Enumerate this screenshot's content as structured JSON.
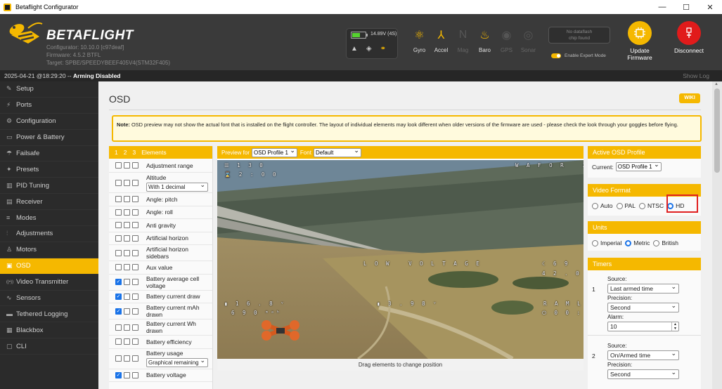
{
  "window": {
    "title": "Betaflight Configurator",
    "controls": [
      "—",
      "☐",
      "✕"
    ]
  },
  "header": {
    "brand": "BETAFLIGHT",
    "configurator": "Configurator: 10.10.0 [c97deaf]",
    "firmware": "Firmware: 4.5.2 BTFL",
    "target": "Target: SPBE/SPEEDYBEEF405V4(STM32F405)",
    "battery_text": "14.89V (4S)",
    "battery_level": 0.55,
    "sensors": [
      {
        "label": "Gyro",
        "icon": "gyro-icon",
        "active": true
      },
      {
        "label": "Accel",
        "icon": "accel-icon",
        "active": true
      },
      {
        "label": "Mag",
        "icon": "mag-icon",
        "active": false
      },
      {
        "label": "Baro",
        "icon": "baro-icon",
        "active": true
      },
      {
        "label": "GPS",
        "icon": "gps-icon",
        "active": false
      },
      {
        "label": "Sonar",
        "icon": "sonar-icon",
        "active": false
      }
    ],
    "dataflash_line1": "No dataflash",
    "dataflash_line2": "chip found",
    "expert_mode": "Enable Expert Mode",
    "update_line1": "Update",
    "update_line2": "Firmware",
    "disconnect": "Disconnect",
    "accent_color": "#f5b800",
    "disconnect_color": "#e11b1b"
  },
  "status": {
    "datetime": "2025-04-21 @18:29:20",
    "separator": " -- ",
    "arming": "Arming Disabled",
    "show_log": "Show Log"
  },
  "sidebar": {
    "items": [
      {
        "label": "Setup",
        "icon": "wrench-icon",
        "glyph": "✎"
      },
      {
        "label": "Ports",
        "icon": "plug-icon",
        "glyph": "⚡"
      },
      {
        "label": "Configuration",
        "icon": "gear-icon",
        "glyph": "⚙"
      },
      {
        "label": "Power & Battery",
        "icon": "battery-icon",
        "glyph": "▭"
      },
      {
        "label": "Failsafe",
        "icon": "parachute-icon",
        "glyph": "☂"
      },
      {
        "label": "Presets",
        "icon": "presets-icon",
        "glyph": "✦"
      },
      {
        "label": "PID Tuning",
        "icon": "sliders-icon",
        "glyph": "▥"
      },
      {
        "label": "Receiver",
        "icon": "receiver-icon",
        "glyph": "▤"
      },
      {
        "label": "Modes",
        "icon": "modes-icon",
        "glyph": "≡"
      },
      {
        "label": "Adjustments",
        "icon": "adjustments-icon",
        "glyph": "⫶"
      },
      {
        "label": "Motors",
        "icon": "motor-icon",
        "glyph": "♙"
      },
      {
        "label": "OSD",
        "icon": "osd-icon",
        "glyph": "▣",
        "active": true
      },
      {
        "label": "Video Transmitter",
        "icon": "vtx-icon",
        "glyph": "((•))"
      },
      {
        "label": "Sensors",
        "icon": "sensors-icon",
        "glyph": "∿"
      },
      {
        "label": "Tethered Logging",
        "icon": "tethered-icon",
        "glyph": "▬"
      },
      {
        "label": "Blackbox",
        "icon": "blackbox-icon",
        "glyph": "▦"
      },
      {
        "label": "CLI",
        "icon": "cli-icon",
        "glyph": "▢"
      }
    ]
  },
  "content": {
    "title": "OSD",
    "wiki": "WIKI",
    "note_label": "Note:",
    "note_text": " OSD preview may not show the actual font that is installed on the flight controller. The layout of individual elements may look different when older versions of the firmware are used - please check the look through your goggles before flying."
  },
  "elements": {
    "profile_nums": [
      "1",
      "2",
      "3"
    ],
    "header_label": "Elements",
    "items": [
      {
        "label": "Adjustment range",
        "checks": [
          false,
          false,
          false
        ]
      },
      {
        "label": "Altitude",
        "checks": [
          false,
          false,
          false
        ],
        "select": "With 1 decimal"
      },
      {
        "label": "Angle: pitch",
        "checks": [
          false,
          false,
          false
        ]
      },
      {
        "label": "Angle: roll",
        "checks": [
          false,
          false,
          false
        ]
      },
      {
        "label": "Anti gravity",
        "checks": [
          false,
          false,
          false
        ]
      },
      {
        "label": "Artificial horizon",
        "checks": [
          false,
          false,
          false
        ]
      },
      {
        "label": "Artificial horizon sidebars",
        "checks": [
          false,
          false,
          false
        ]
      },
      {
        "label": "Aux value",
        "checks": [
          false,
          false,
          false
        ]
      },
      {
        "label": "Battery average cell voltage",
        "checks": [
          true,
          false,
          false
        ]
      },
      {
        "label": "Battery current draw",
        "checks": [
          true,
          false,
          false
        ]
      },
      {
        "label": "Battery current mAh drawn",
        "checks": [
          true,
          false,
          false
        ]
      },
      {
        "label": "Battery current Wh drawn",
        "checks": [
          false,
          false,
          false
        ]
      },
      {
        "label": "Battery efficiency",
        "checks": [
          false,
          false,
          false
        ]
      },
      {
        "label": "Battery usage",
        "checks": [
          false,
          false,
          false
        ],
        "select": "Graphical remaining"
      },
      {
        "label": "Battery voltage",
        "checks": [
          true,
          false,
          false
        ]
      }
    ]
  },
  "preview": {
    "preview_for": "Preview for",
    "profile_select": "OSD Profile 1",
    "font_label": "Font",
    "font_select": "Default",
    "drag_hint": "Drag elements to change position",
    "osd": {
      "tl1": "☰ 1 3 0",
      "tl2": "⌛ 2 : 0 0",
      "craft": "W A F O R   X 5",
      "warning": "L O W   V O L T A G E",
      "r1": "☾ 6 9",
      "r2": "4 2 . 0 0 ⌂",
      "bat_v": "▮ 1 6 . 8 ᵛ",
      "mah": "6 9 0 ᵐᵃʰ",
      "cell": "▮ 3 . 9 8 ᵛ",
      "rssi": "R A M L",
      "time": "⏻ 0 0 : 0 0"
    }
  },
  "active_profile": {
    "title": "Active OSD Profile",
    "current_label": "Current:",
    "value": "OSD Profile 1"
  },
  "video_format": {
    "title": "Video Format",
    "options": [
      {
        "label": "Auto",
        "checked": false
      },
      {
        "label": "PAL",
        "checked": false
      },
      {
        "label": "NTSC",
        "checked": false
      },
      {
        "label": "HD",
        "checked": true
      }
    ]
  },
  "units": {
    "title": "Units",
    "options": [
      {
        "label": "Imperial",
        "checked": false
      },
      {
        "label": "Metric",
        "checked": true
      },
      {
        "label": "British",
        "checked": false
      }
    ]
  },
  "timers": {
    "title": "Timers",
    "items": [
      {
        "num": "1",
        "source_label": "Source:",
        "source": "Last armed time",
        "precision_label": "Precision:",
        "precision": "Second",
        "alarm_label": "Alarm:",
        "alarm": "10"
      },
      {
        "num": "2",
        "source_label": "Source:",
        "source": "On/Armed time",
        "precision_label": "Precision:",
        "precision": "Second"
      }
    ]
  }
}
